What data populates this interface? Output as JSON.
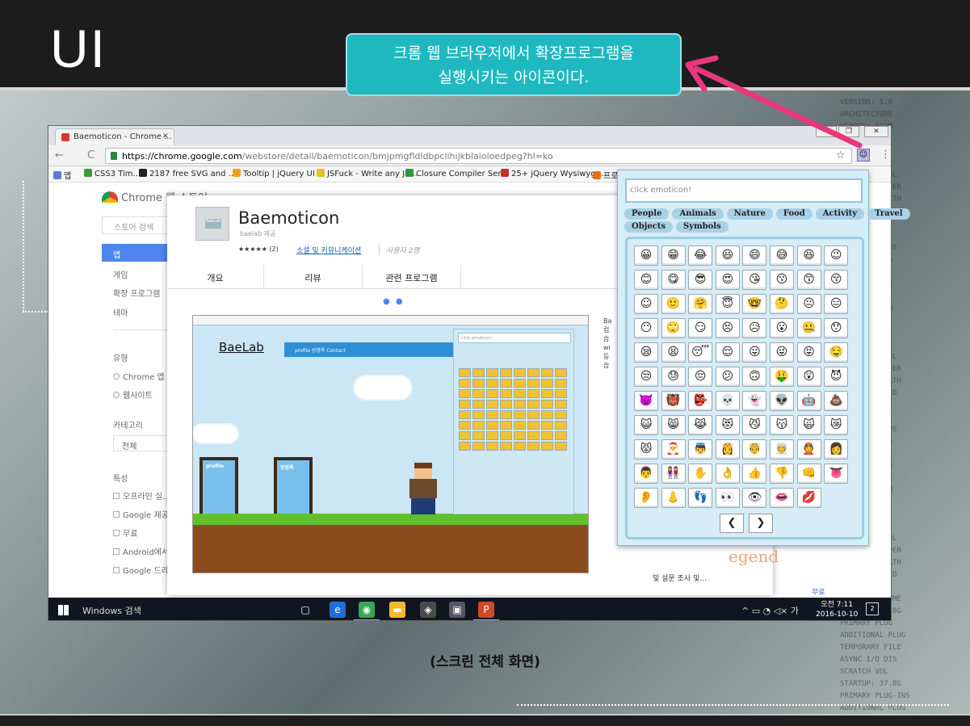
{
  "slide": {
    "title": "UI",
    "callout_line1": "크롬 웹 브라우저에서 확장프로그램을",
    "callout_line2": "실행시키는 아이콘이다.",
    "caption": "(스크린 전체 화면)",
    "colors": {
      "callout": "#1fb8c0",
      "arrow": "#e8377d",
      "top_bar": "#1c1c1c"
    }
  },
  "browser": {
    "tab_title": "Baemoticon - Chrome ...",
    "tab_close": "×",
    "url_host": "https://chrome.google.com",
    "url_path": "/webstore/detail/baemoticon/bmjpmgfldldbpclihijkblaioloedpeg?hl=ko",
    "star_icon": "☆",
    "extension_icon": "☺",
    "menu_icon": "⋮",
    "back_icon": "←",
    "reload_icon": "C",
    "win_min": "—",
    "win_max": "❐",
    "win_close": "✕",
    "bookmarks": [
      {
        "label": "앱",
        "color": "#5b7cd6"
      },
      {
        "label": "CSS3 Tim...",
        "color": "#3a9a3a"
      },
      {
        "label": "2187 free SVG and ...",
        "color": "#222"
      },
      {
        "label": "Tooltip | jQuery UI",
        "color": "#f0a020"
      },
      {
        "label": "JSFuck - Write any Ja...",
        "color": "#e8c020"
      },
      {
        "label": "Closure Compiler Ser...",
        "color": "#2a9a3a"
      },
      {
        "label": "25+ jQuery Wysiwyg ...",
        "color": "#c03030"
      },
      {
        "label": "프로",
        "color": "#e07020"
      }
    ]
  },
  "store": {
    "logo": "Chrome 웹 스토어",
    "search_placeholder": "스토어 검색",
    "nav_active": "앱",
    "nav": [
      "게임",
      "확장 프로그램",
      "테마"
    ],
    "type_heading": "유형",
    "types": [
      "Chrome 앱",
      "웹사이트"
    ],
    "category_heading": "카테고리",
    "category_value": "전체",
    "features_heading": "특성",
    "features": [
      "오프라인 실...",
      "Google 제공",
      "무료",
      "Android에서...",
      "Google 드라..."
    ]
  },
  "detail": {
    "app_name": "Baemoticon",
    "puzzle_label": "BaeLab",
    "publisher": "baelab 제공",
    "rating": "★★★★★ (2)",
    "category_link": "소셜 및 커뮤니케이션",
    "users": "사용자 2명",
    "tabs": [
      "개요",
      "리뷰",
      "관련 프로그램"
    ],
    "carousel_dots": "● ●",
    "preview_brand": "BaeLab",
    "preview_nav": "profile    방명록    Contact",
    "preview_door1": "profile",
    "preview_door2": "방명록",
    "preview_popup_placeholder": "click emoticon!",
    "info_text": "Ba\n컴\n습\nwi\n등\n습",
    "legend_text": "egend",
    "survey_text": "및 설문 조사 및...",
    "free_text": "무료"
  },
  "taskbar": {
    "search": "Windows 검색",
    "tray": "^ ▭ ◔ ◁× 가",
    "time": "오전 7:11",
    "date": "2016-10-10",
    "notif_count": "2",
    "apps": [
      {
        "icon": "▢",
        "color": "transparent"
      },
      {
        "icon": "e",
        "color": "#1e6fd9"
      },
      {
        "icon": "◉",
        "color": "#34a853"
      },
      {
        "icon": "▬",
        "color": "#f3b92a"
      },
      {
        "icon": "◈",
        "color": "#4a4a4a"
      },
      {
        "icon": "▣",
        "color": "#556"
      },
      {
        "icon": "P",
        "color": "#d24726"
      }
    ]
  },
  "popup": {
    "placeholder": "click emoticon!",
    "categories_row1": [
      "People",
      "Animals",
      "Nature",
      "Food",
      "Activity",
      "Travel"
    ],
    "categories_row2": [
      "Objects",
      "Symbols"
    ],
    "prev": "❮",
    "next": "❯",
    "emoticons": [
      "😀",
      "😁",
      "😂",
      "😃",
      "😄",
      "😅",
      "😆",
      "😉",
      "😊",
      "😋",
      "😎",
      "😍",
      "😘",
      "😗",
      "😙",
      "😚",
      "☺",
      "🙂",
      "🤗",
      "😇",
      "🤓",
      "🤔",
      "😐",
      "😑",
      "😶",
      "🙄",
      "😏",
      "😣",
      "😥",
      "😮",
      "🤐",
      "😯",
      "😪",
      "😫",
      "😴",
      "😌",
      "😛",
      "😜",
      "😝",
      "🤤",
      "😒",
      "😓",
      "😔",
      "😕",
      "🙃",
      "🤑",
      "😲",
      "😈",
      "👿",
      "👹",
      "👺",
      "💀",
      "👻",
      "👽",
      "🤖",
      "💩",
      "😺",
      "😸",
      "😹",
      "😻",
      "😼",
      "😽",
      "🙀",
      "😿",
      "😾",
      "🎅",
      "👼",
      "👸",
      "🤴",
      "👳",
      "👲",
      "👩",
      "👨",
      "👭",
      "✋",
      "👌",
      "👍",
      "👎",
      "👊",
      "👅",
      "👂",
      "👃",
      "👣",
      "👀",
      "👁",
      "👄",
      "💋"
    ]
  },
  "code_text": "VERSION: 5.0\nARCHITECTURE\nMEMORY: 512M\nAVAILABLE:\nUSED: 80 K\nCACHE LEVELS\nIO CACHE POOL\nPROGRAM FOLDER\nTEMP FILE PATH\nDISK DISABLED\nVOLUME(S):\nSYS: 37.8G\nREAL PLUG-INS\nPRIMARY PLUG\nADDITIONAL\nVERSION: 5.0\nARCHITECTURE\nMEMORY: 512M\nAVAILABLE:\nUSED: 80 K\nCACHE LEVELS\nIO CACHE POOL\nPROGRAM FOLDER\nTEMP FILE PATH\nDISK DISABLED\nVOLUME(S):\nSYS: 37.8G\nREAL PLUG-INS\nPRIMARY PLUG\nADDITIONAL\nVERSION: 5.0\nARCHITECTURE\nMEMORY: 512M\nAVAILABLE:\nUSED: 80 K\nCACHE LEVELS\nIO CACHE POOL\nPROGRAM FOLDER\nTEMP FILE PATH\nDISK DISABLED\nVOLUME(S):\nSCRATCH VOLUME\nSTARTUP: 37.8G\nPRIMARY PLUG\nADDITIONAL PLUG\nTEMPORARY FILE\nASYNC I/O DIS\nSCRATCH VOL\nSTARTUP: 37.8G\nPRIMARY PLUG-INS\nADDITIONAL PLUG"
}
